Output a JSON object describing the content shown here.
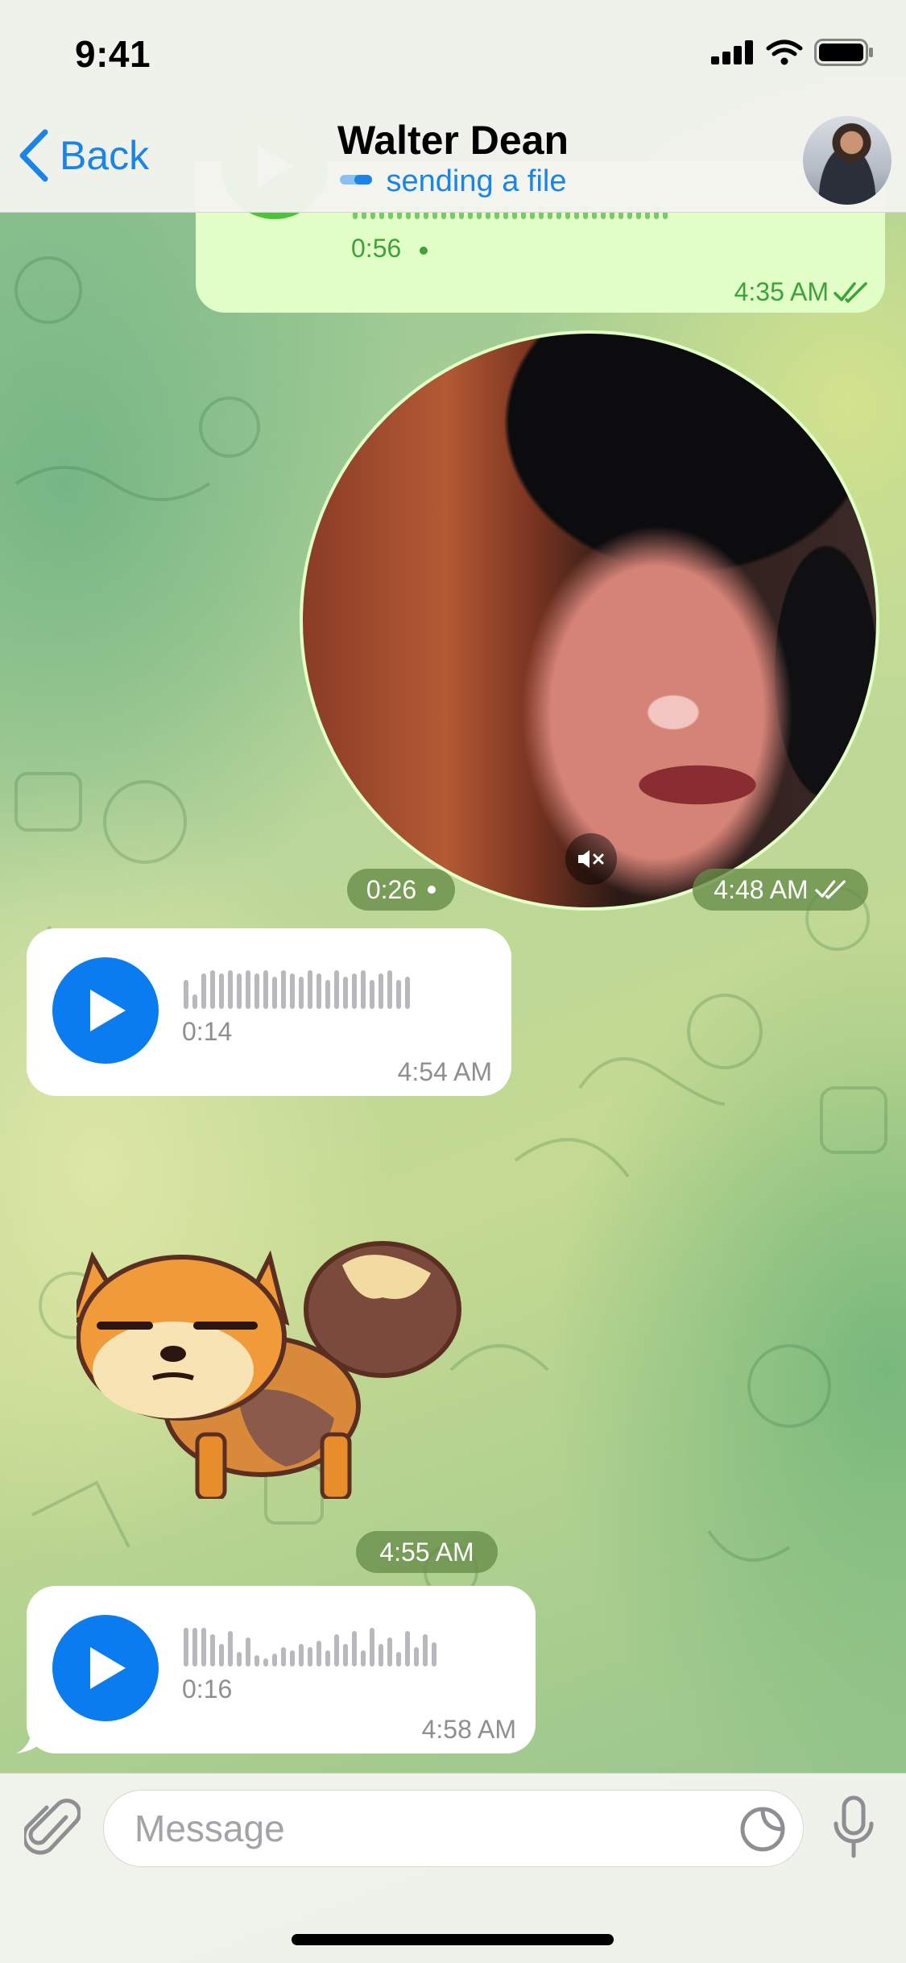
{
  "status_bar": {
    "time": "9:41"
  },
  "header": {
    "back_label": "Back",
    "title": "Walter Dean",
    "subtitle": "sending a file"
  },
  "messages": [
    {
      "kind": "voice",
      "direction": "outgoing",
      "duration": "0:56",
      "time": "4:35 AM",
      "read": true
    },
    {
      "kind": "video_note",
      "direction": "outgoing",
      "duration": "0:26",
      "time": "4:48 AM",
      "read": true
    },
    {
      "kind": "voice",
      "direction": "incoming",
      "duration": "0:14",
      "time": "4:54 AM"
    },
    {
      "kind": "sticker",
      "direction": "incoming",
      "time": "4:55 AM"
    },
    {
      "kind": "voice",
      "direction": "incoming",
      "duration": "0:16",
      "time": "4:58 AM"
    }
  ],
  "input": {
    "placeholder": "Message"
  },
  "colors": {
    "accent": "#1a84e8",
    "outgoing_bubble": "#e1ffc7",
    "outgoing_play": "#4fc23a",
    "incoming_play": "#0a7cf0",
    "time_pill": "#668c48"
  },
  "icons": [
    "chevron-left-icon",
    "signal-icon",
    "wifi-icon",
    "battery-icon",
    "play-icon",
    "mute-icon",
    "double-check-icon",
    "paperclip-icon",
    "sticker-icon",
    "microphone-icon"
  ]
}
